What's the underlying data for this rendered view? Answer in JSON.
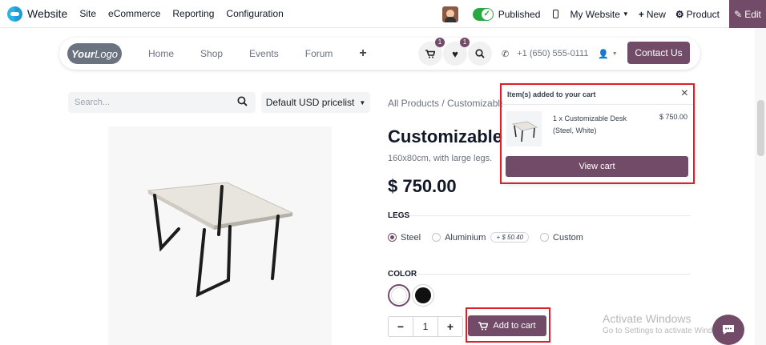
{
  "topbar": {
    "app_name": "Website",
    "menu": [
      "Site",
      "eCommerce",
      "Reporting",
      "Configuration"
    ],
    "published_label": "Published",
    "my_website_label": "My Website",
    "new_label": "New",
    "product_label": "Product",
    "edit_label": "Edit"
  },
  "header": {
    "logo_text_1": "Your",
    "logo_text_2": "Logo",
    "nav": [
      "Home",
      "Shop",
      "Events",
      "Forum"
    ],
    "plus": "+",
    "cart_badge": "1",
    "wishlist_badge": "1",
    "phone": "+1 (650) 555-0111",
    "contact_label": "Contact Us"
  },
  "shop": {
    "search_placeholder": "Search...",
    "pricelist": "Default USD pricelist",
    "breadcrumb": "All Products  /  Customizable"
  },
  "product": {
    "title": "Customizable",
    "description": "160x80cm, with large legs.",
    "price": "$ 750.00",
    "legs_label": "LEGS",
    "legs_options": [
      "Steel",
      "Aluminium",
      "Custom"
    ],
    "aluminium_extra": "+ $ 50.40",
    "color_label": "COLOR",
    "colors": [
      "#ffffff",
      "#111111"
    ],
    "quantity": "1",
    "add_to_cart_label": "Add to cart"
  },
  "popup": {
    "title": "Item(s) added to your cart",
    "item_line1": "1 x Customizable Desk",
    "item_line2": "(Steel, White)",
    "item_price": "$ 750.00",
    "view_cart_label": "View cart"
  },
  "watermark": {
    "title": "Activate Windows",
    "subtitle": "Go to Settings to activate Windows."
  },
  "colors": {
    "brand": "#714b67",
    "highlight": "#dc1f2a",
    "published": "#28a745"
  }
}
